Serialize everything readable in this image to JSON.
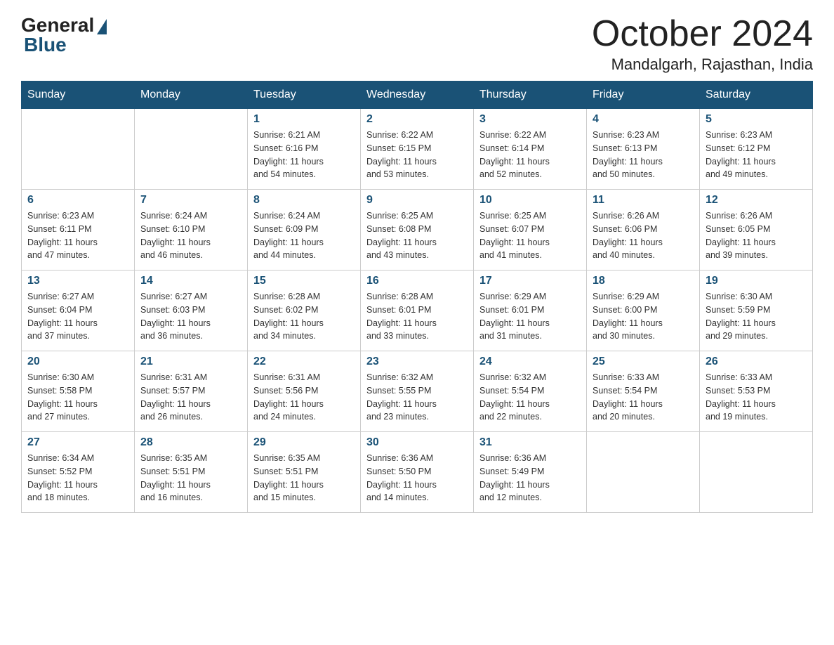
{
  "logo": {
    "general": "General",
    "blue": "Blue"
  },
  "title": {
    "month": "October 2024",
    "location": "Mandalgarh, Rajasthan, India"
  },
  "weekdays": [
    "Sunday",
    "Monday",
    "Tuesday",
    "Wednesday",
    "Thursday",
    "Friday",
    "Saturday"
  ],
  "weeks": [
    [
      {
        "day": "",
        "info": ""
      },
      {
        "day": "",
        "info": ""
      },
      {
        "day": "1",
        "info": "Sunrise: 6:21 AM\nSunset: 6:16 PM\nDaylight: 11 hours\nand 54 minutes."
      },
      {
        "day": "2",
        "info": "Sunrise: 6:22 AM\nSunset: 6:15 PM\nDaylight: 11 hours\nand 53 minutes."
      },
      {
        "day": "3",
        "info": "Sunrise: 6:22 AM\nSunset: 6:14 PM\nDaylight: 11 hours\nand 52 minutes."
      },
      {
        "day": "4",
        "info": "Sunrise: 6:23 AM\nSunset: 6:13 PM\nDaylight: 11 hours\nand 50 minutes."
      },
      {
        "day": "5",
        "info": "Sunrise: 6:23 AM\nSunset: 6:12 PM\nDaylight: 11 hours\nand 49 minutes."
      }
    ],
    [
      {
        "day": "6",
        "info": "Sunrise: 6:23 AM\nSunset: 6:11 PM\nDaylight: 11 hours\nand 47 minutes."
      },
      {
        "day": "7",
        "info": "Sunrise: 6:24 AM\nSunset: 6:10 PM\nDaylight: 11 hours\nand 46 minutes."
      },
      {
        "day": "8",
        "info": "Sunrise: 6:24 AM\nSunset: 6:09 PM\nDaylight: 11 hours\nand 44 minutes."
      },
      {
        "day": "9",
        "info": "Sunrise: 6:25 AM\nSunset: 6:08 PM\nDaylight: 11 hours\nand 43 minutes."
      },
      {
        "day": "10",
        "info": "Sunrise: 6:25 AM\nSunset: 6:07 PM\nDaylight: 11 hours\nand 41 minutes."
      },
      {
        "day": "11",
        "info": "Sunrise: 6:26 AM\nSunset: 6:06 PM\nDaylight: 11 hours\nand 40 minutes."
      },
      {
        "day": "12",
        "info": "Sunrise: 6:26 AM\nSunset: 6:05 PM\nDaylight: 11 hours\nand 39 minutes."
      }
    ],
    [
      {
        "day": "13",
        "info": "Sunrise: 6:27 AM\nSunset: 6:04 PM\nDaylight: 11 hours\nand 37 minutes."
      },
      {
        "day": "14",
        "info": "Sunrise: 6:27 AM\nSunset: 6:03 PM\nDaylight: 11 hours\nand 36 minutes."
      },
      {
        "day": "15",
        "info": "Sunrise: 6:28 AM\nSunset: 6:02 PM\nDaylight: 11 hours\nand 34 minutes."
      },
      {
        "day": "16",
        "info": "Sunrise: 6:28 AM\nSunset: 6:01 PM\nDaylight: 11 hours\nand 33 minutes."
      },
      {
        "day": "17",
        "info": "Sunrise: 6:29 AM\nSunset: 6:01 PM\nDaylight: 11 hours\nand 31 minutes."
      },
      {
        "day": "18",
        "info": "Sunrise: 6:29 AM\nSunset: 6:00 PM\nDaylight: 11 hours\nand 30 minutes."
      },
      {
        "day": "19",
        "info": "Sunrise: 6:30 AM\nSunset: 5:59 PM\nDaylight: 11 hours\nand 29 minutes."
      }
    ],
    [
      {
        "day": "20",
        "info": "Sunrise: 6:30 AM\nSunset: 5:58 PM\nDaylight: 11 hours\nand 27 minutes."
      },
      {
        "day": "21",
        "info": "Sunrise: 6:31 AM\nSunset: 5:57 PM\nDaylight: 11 hours\nand 26 minutes."
      },
      {
        "day": "22",
        "info": "Sunrise: 6:31 AM\nSunset: 5:56 PM\nDaylight: 11 hours\nand 24 minutes."
      },
      {
        "day": "23",
        "info": "Sunrise: 6:32 AM\nSunset: 5:55 PM\nDaylight: 11 hours\nand 23 minutes."
      },
      {
        "day": "24",
        "info": "Sunrise: 6:32 AM\nSunset: 5:54 PM\nDaylight: 11 hours\nand 22 minutes."
      },
      {
        "day": "25",
        "info": "Sunrise: 6:33 AM\nSunset: 5:54 PM\nDaylight: 11 hours\nand 20 minutes."
      },
      {
        "day": "26",
        "info": "Sunrise: 6:33 AM\nSunset: 5:53 PM\nDaylight: 11 hours\nand 19 minutes."
      }
    ],
    [
      {
        "day": "27",
        "info": "Sunrise: 6:34 AM\nSunset: 5:52 PM\nDaylight: 11 hours\nand 18 minutes."
      },
      {
        "day": "28",
        "info": "Sunrise: 6:35 AM\nSunset: 5:51 PM\nDaylight: 11 hours\nand 16 minutes."
      },
      {
        "day": "29",
        "info": "Sunrise: 6:35 AM\nSunset: 5:51 PM\nDaylight: 11 hours\nand 15 minutes."
      },
      {
        "day": "30",
        "info": "Sunrise: 6:36 AM\nSunset: 5:50 PM\nDaylight: 11 hours\nand 14 minutes."
      },
      {
        "day": "31",
        "info": "Sunrise: 6:36 AM\nSunset: 5:49 PM\nDaylight: 11 hours\nand 12 minutes."
      },
      {
        "day": "",
        "info": ""
      },
      {
        "day": "",
        "info": ""
      }
    ]
  ]
}
